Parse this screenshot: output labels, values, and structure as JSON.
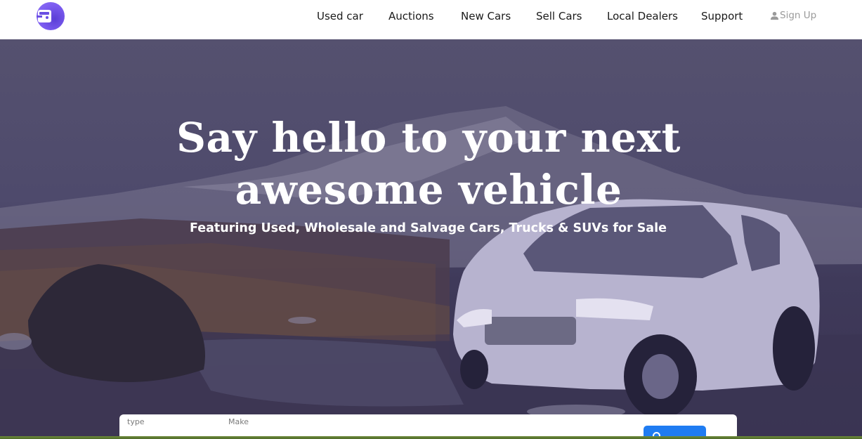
{
  "brand": {
    "logo_icon": "car-front-icon",
    "accent": "#7c5cf0"
  },
  "nav": {
    "items": [
      {
        "label": "Used car"
      },
      {
        "label": "Auctions"
      },
      {
        "label": "New Cars"
      },
      {
        "label": "Sell Cars"
      },
      {
        "label": "Local Dealers"
      },
      {
        "label": "Support"
      }
    ],
    "signup": {
      "label": "Sign Up",
      "icon": "user-icon"
    }
  },
  "hero": {
    "title_line1": "Say hello to your next",
    "title_line2": "awesome vehicle",
    "subtitle": "Featuring Used, Wholesale and Salvage Cars, Trucks & SUVs for Sale"
  },
  "search": {
    "fields": [
      {
        "label": "type"
      },
      {
        "label": "Make"
      }
    ],
    "button_icon": "search-icon",
    "button_color": "#1f7cf2"
  }
}
